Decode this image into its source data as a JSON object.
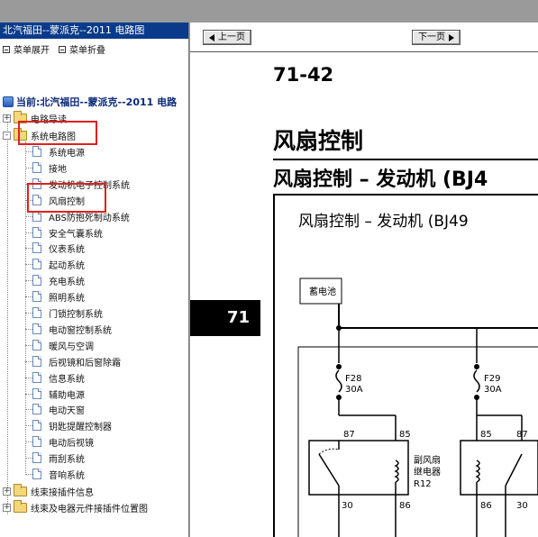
{
  "tree": {
    "title": "北汽福田--蒙派克--2011 电路图",
    "toolbar": {
      "expand_label": "菜单展开",
      "collapse_label": "菜单折叠"
    },
    "root_label": "当前:北汽福田--蒙派克--2011 电路",
    "folders": [
      {
        "label": "电路导读",
        "expander": "+"
      },
      {
        "label": "系统电路图",
        "expander": "-"
      }
    ],
    "items": [
      "系统电源",
      "接地",
      "发动机电子控制系统",
      "风扇控制",
      "ABS防抱死制动系统",
      "安全气囊系统",
      "仪表系统",
      "起动系统",
      "充电系统",
      "照明系统",
      "门锁控制系统",
      "电动窗控制系统",
      "暖风与空调",
      "后视镜和后窗除霜",
      "信息系统",
      "辅助电源",
      "电动天窗",
      "钥匙提醒控制器",
      "电动后视镜",
      "雨刮系统",
      "音响系统"
    ],
    "bottom_folders": [
      {
        "label": "线束接插件信息",
        "expander": "+"
      },
      {
        "label": "线束及电器元件接插件位置图",
        "expander": "+"
      }
    ]
  },
  "viewer": {
    "prev_label": "上一页",
    "next_label": "下一页",
    "page_number": "71-42",
    "title": "风扇控制",
    "subtitle": "风扇控制 – 发动机 (BJ4",
    "section_tab": "71",
    "diagram": {
      "title": "风扇控制 – 发动机 (BJ49",
      "battery_label": "蓄电池",
      "fuse1": {
        "name": "F28",
        "rating": "30A"
      },
      "fuse2": {
        "name": "F29",
        "rating": "30A"
      },
      "relay_label_1": "副风扇",
      "relay_label_2": "继电器",
      "relay_label_3": "R12",
      "pins_left": {
        "p87": "87",
        "p85": "85",
        "p30": "30",
        "p86": "86"
      },
      "pins_right": {
        "p85": "85",
        "p87": "87",
        "p86": "86",
        "p30": "30"
      }
    }
  },
  "colors": {
    "tree_title_bg": "#0a3a8a",
    "highlight": "#e02020"
  }
}
